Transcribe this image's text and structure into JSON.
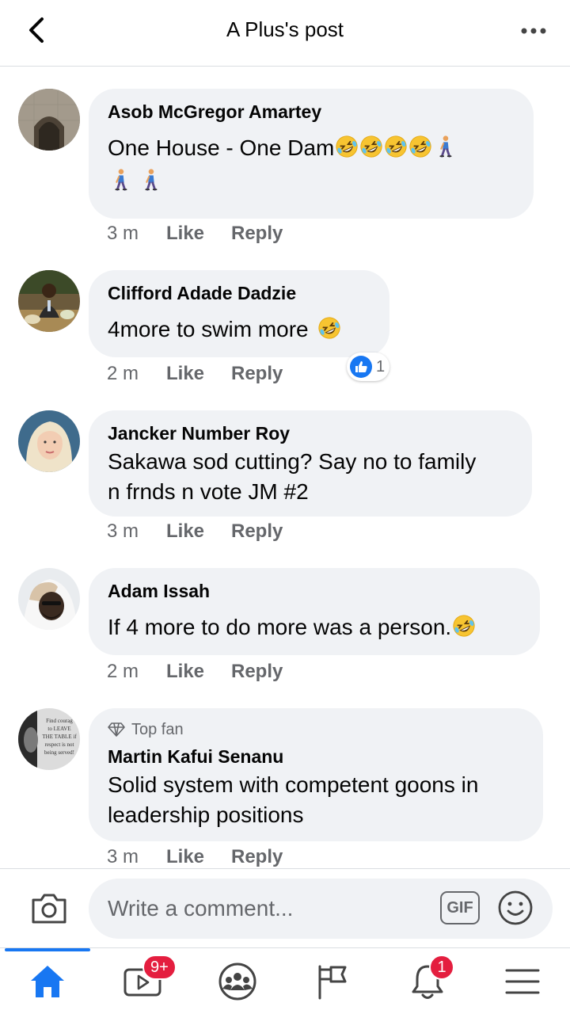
{
  "header": {
    "title": "A Plus's post",
    "back_icon": "chevron-left-icon",
    "more_icon": "more-horizontal-icon"
  },
  "comments": [
    {
      "author": "Asob McGregor Amartey",
      "text_line1": "One House - One Dam",
      "time": "3 m",
      "like": "Like",
      "reply": "Reply",
      "emojis": [
        "rolling-on-floor-laughing-emoji",
        "person-walking-emoji"
      ]
    },
    {
      "author": "Clifford Adade Dadzie",
      "text": "4more to swim more",
      "time": "2 m",
      "like": "Like",
      "reply": "Reply",
      "reaction_count": "1",
      "reaction_icon": "like-thumb-icon"
    },
    {
      "author": "Jancker Number Roy",
      "text_line1": "Sakawa sod cutting? Say no to family",
      "text_line2": "n frnds n vote JM #2",
      "time": "3 m",
      "like": "Like",
      "reply": "Reply"
    },
    {
      "author": "Adam Issah",
      "text": "If 4 more to do more was a person.",
      "time": "2 m",
      "like": "Like",
      "reply": "Reply"
    },
    {
      "badge": "Top fan",
      "author": "Martin Kafui Senanu",
      "text_line1": "Solid system with competent goons in",
      "text_line2": "leadership positions",
      "time": "3 m",
      "like": "Like",
      "reply": "Reply",
      "avatar_quote": [
        "Find courag",
        "to LEAVE",
        "THE TABLE if",
        "respect is not",
        "being served!"
      ]
    }
  ],
  "composer": {
    "placeholder": "Write a comment...",
    "gif_label": "GIF",
    "camera_icon": "camera-icon",
    "emoji_icon": "smiley-icon"
  },
  "tabbar": {
    "video_badge": "9+",
    "notifications_badge": "1",
    "active_color": "#1877f2",
    "badge_color": "#e41e3f"
  }
}
